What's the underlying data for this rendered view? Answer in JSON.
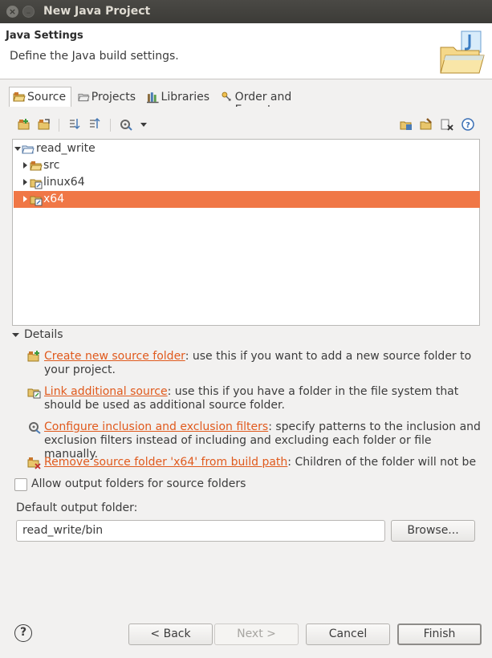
{
  "window": {
    "title": "New Java Project",
    "close_glyph": "×",
    "minimize_glyph": "–"
  },
  "header": {
    "title": "Java Settings",
    "description": "Define the Java build settings.",
    "image_icon": "java-folder-banner-icon"
  },
  "tabs": [
    {
      "label": "Source",
      "icon": "source-folder-icon",
      "active": true
    },
    {
      "label": "Projects",
      "icon": "projects-icon",
      "active": false
    },
    {
      "label": "Libraries",
      "icon": "libraries-icon",
      "active": false
    },
    {
      "label": "Order and Export",
      "icon": "order-export-icon",
      "active": false
    }
  ],
  "toolbar": {
    "left_icons": [
      "add-source-folder-icon",
      "link-source-folder-icon",
      "import-icon",
      "export-icon",
      "configure-build-path-icon",
      "dropdown-arrow-icon"
    ],
    "right_icons": [
      "new-source-folder-icon",
      "edit-icon",
      "remove-icon",
      "help-icon"
    ]
  },
  "tree": {
    "rows": [
      {
        "label": "read_write",
        "icon": "project-folder-icon",
        "expanded": true,
        "level": 0,
        "selected": false
      },
      {
        "label": "src",
        "icon": "package-folder-icon",
        "expanded": false,
        "level": 1,
        "selected": false
      },
      {
        "label": "linux64",
        "icon": "linked-folder-icon",
        "expanded": false,
        "level": 1,
        "selected": false
      },
      {
        "label": "x64",
        "icon": "linked-folder-icon",
        "expanded": false,
        "level": 1,
        "selected": true
      }
    ]
  },
  "details": {
    "label": "Details",
    "items": [
      {
        "link": "Create new source folder",
        "text_line1": ": use this if you want to add a new source folder to",
        "text_line2": "your project."
      },
      {
        "link": "Link additional source",
        "text_line1": ": use this if you have a folder in the file system that",
        "text_line2": "should be used as additional source folder."
      },
      {
        "link": "Configure inclusion and exclusion filters",
        "text_line1": ": specify patterns to the inclusion and",
        "text_line2": "exclusion filters instead of including and excluding each folder or file manually."
      },
      {
        "link": "Remove source folder 'x64' from build path",
        "text_line1": ": Children of the folder will not be",
        "text_line2": ""
      }
    ]
  },
  "options": {
    "allow_output_folders_label": "Allow output folders for source folders",
    "allow_output_folders_checked": false
  },
  "output": {
    "label": "Default output folder:",
    "value": "read_write/bin",
    "browse_label": "Browse..."
  },
  "buttons": {
    "help_glyph": "?",
    "back": "< Back",
    "next": "Next >",
    "cancel": "Cancel",
    "finish": "Finish"
  },
  "colors": {
    "selection": "#f07746",
    "link": "#e05a1d",
    "titlebar": "#3c3b37"
  }
}
